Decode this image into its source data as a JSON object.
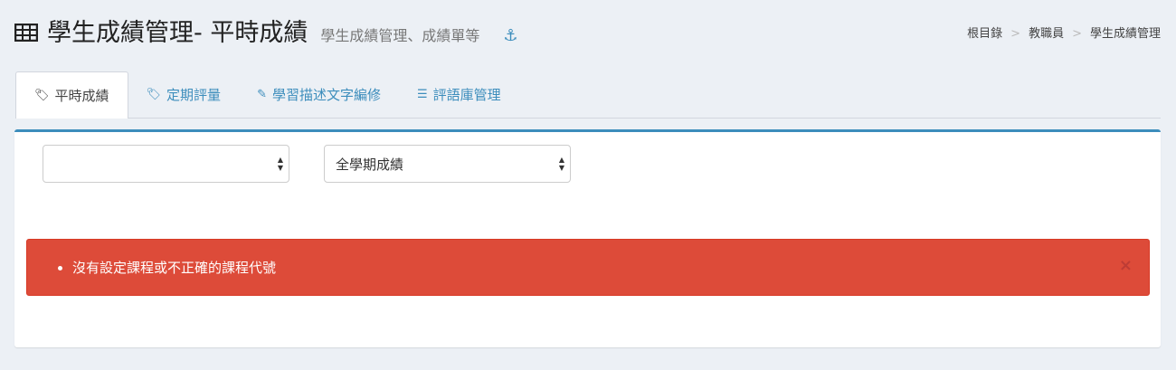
{
  "header": {
    "title": "學生成績管理- 平時成績",
    "subtitle": "學生成績管理、成績單等",
    "anchor_icon": "anchor-icon"
  },
  "breadcrumb": [
    "根目錄",
    "教職員",
    "學生成績管理"
  ],
  "breadcrumb_sep": ">",
  "tabs": [
    {
      "label": "平時成績",
      "icon": "tag"
    },
    {
      "label": "定期評量",
      "icon": "tags"
    },
    {
      "label": "學習描述文字編修",
      "icon": "edit"
    },
    {
      "label": "評語庫管理",
      "icon": "database"
    }
  ],
  "filters": {
    "course_select": "",
    "period_select": "全學期成績"
  },
  "alert": {
    "message": "沒有設定課程或不正確的課程代號",
    "close": "×"
  },
  "colors": {
    "accent": "#3c8dbc",
    "danger": "#dd4b39",
    "background": "#ecf0f5"
  }
}
